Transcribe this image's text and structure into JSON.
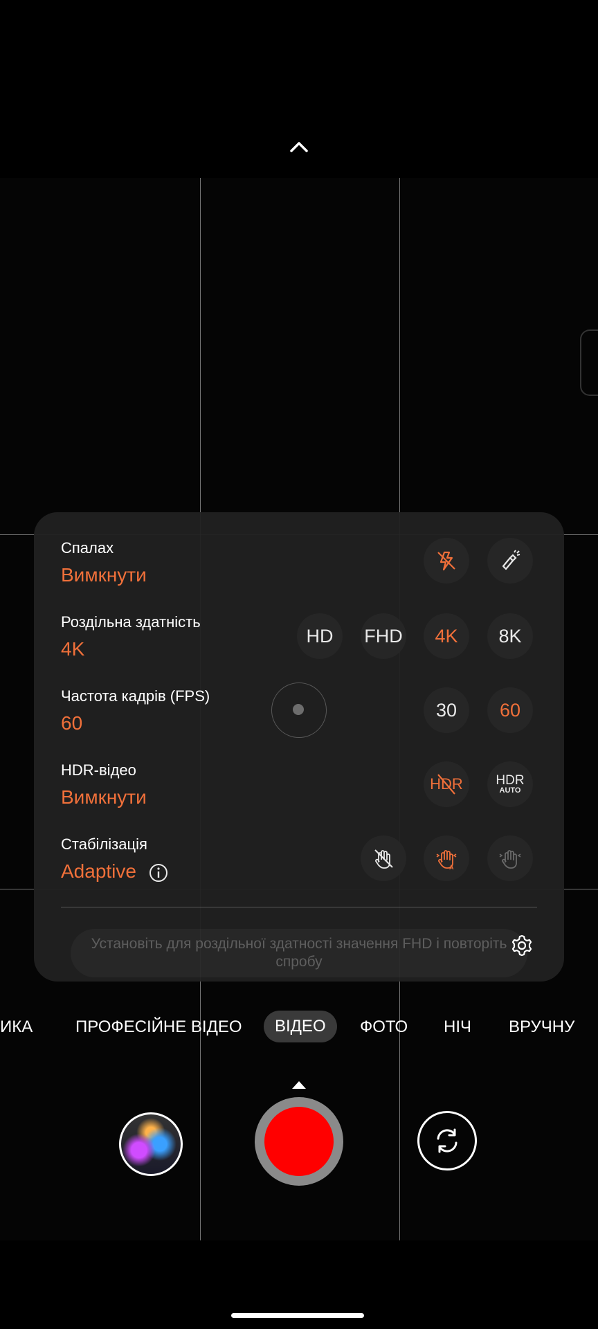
{
  "flash": {
    "title": "Спалах",
    "value": "Вимкнути"
  },
  "resolution": {
    "title": "Роздільна здатність",
    "value": "4K",
    "options": [
      "HD",
      "FHD",
      "4K",
      "8K"
    ]
  },
  "fps": {
    "title": "Частота кадрів (FPS)",
    "value": "60",
    "options": [
      "30",
      "60"
    ]
  },
  "hdr": {
    "title": "HDR-відео",
    "value": "Вимкнути",
    "auto_label_top": "HDR",
    "auto_label_bottom": "AUTO",
    "off_label": "HDR"
  },
  "stabilization": {
    "title": "Стабілізація",
    "value": "Adaptive"
  },
  "toast": {
    "text": "Установіть для роздільної здатності значення FHD і повторіть спробу"
  },
  "modes": [
    "ИКА",
    "ПРОФЕСІЙНЕ ВІДЕО",
    "ВІДЕО",
    "ФОТО",
    "НІЧ",
    "ВРУЧНУ"
  ],
  "active_mode": "ВІДЕО",
  "colors": {
    "accent": "#f0703a",
    "record": "#ff0000",
    "panel": "#202020"
  }
}
